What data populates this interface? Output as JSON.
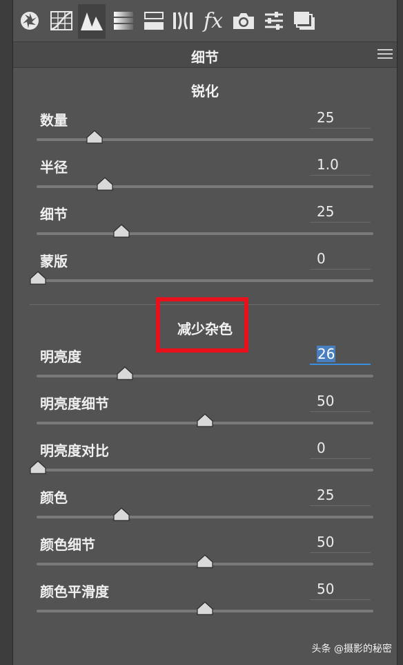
{
  "toolbar": {
    "tools": [
      {
        "icon": "aperture-icon"
      },
      {
        "icon": "tone-curve-grid-icon"
      },
      {
        "icon": "detail-triangles-icon"
      },
      {
        "icon": "hsl-gradient-icon"
      },
      {
        "icon": "split-toning-icon"
      },
      {
        "icon": "lens-correction-icon"
      },
      {
        "icon": "fx-icon"
      },
      {
        "icon": "camera-icon"
      },
      {
        "icon": "presets-sliders-icon"
      },
      {
        "icon": "snapshots-icon"
      }
    ],
    "fx_text": "fx"
  },
  "panel": {
    "title": "细节"
  },
  "sharpening": {
    "title": "锐化",
    "rows": [
      {
        "label": "数量",
        "value": "25",
        "fraction": 0.17
      },
      {
        "label": "半径",
        "value": "1.0",
        "fraction": 0.2
      },
      {
        "label": "细节",
        "value": "25",
        "fraction": 0.25
      },
      {
        "label": "蒙版",
        "value": "0",
        "fraction": 0.0
      }
    ]
  },
  "noise_reduction": {
    "title": "减少杂色",
    "rows": [
      {
        "label": "明亮度",
        "value": "26",
        "fraction": 0.26,
        "focused": true
      },
      {
        "label": "明亮度细节",
        "value": "50",
        "fraction": 0.5
      },
      {
        "label": "明亮度对比",
        "value": "0",
        "fraction": 0.0
      },
      {
        "label": "颜色",
        "value": "25",
        "fraction": 0.25
      },
      {
        "label": "颜色细节",
        "value": "50",
        "fraction": 0.5
      },
      {
        "label": "颜色平滑度",
        "value": "50",
        "fraction": 0.5
      }
    ]
  },
  "colors": {
    "accent": "#3b8fe0",
    "highlight_box": "#e8101a"
  },
  "watermark": "头条 @摄影的秘密"
}
